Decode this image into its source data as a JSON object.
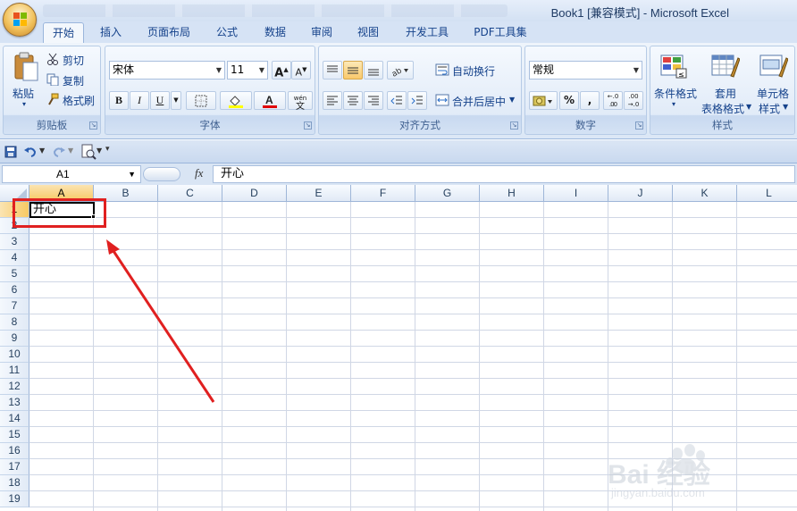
{
  "window": {
    "title": "Book1  [兼容模式] - Microsoft Excel"
  },
  "tabs": [
    {
      "label": "开始",
      "active": true
    },
    {
      "label": "插入"
    },
    {
      "label": "页面布局"
    },
    {
      "label": "公式"
    },
    {
      "label": "数据"
    },
    {
      "label": "审阅"
    },
    {
      "label": "视图"
    },
    {
      "label": "开发工具"
    },
    {
      "label": "PDF工具集"
    }
  ],
  "ribbon": {
    "clipboard": {
      "label": "剪贴板",
      "paste": "粘贴",
      "cut": "剪切",
      "copy": "复制",
      "format_painter": "格式刷"
    },
    "font": {
      "label": "字体",
      "font_name": "宋体",
      "font_size": "11",
      "bold": "B",
      "italic": "I",
      "underline": "U",
      "grow": "A",
      "shrink": "A",
      "phonetic": "文"
    },
    "alignment": {
      "label": "对齐方式",
      "wrap_text": "自动换行",
      "merge_center": "合并后居中"
    },
    "number": {
      "label": "数字",
      "format": "常规",
      "percent": "%",
      "comma": ",",
      "increase_decimal": ".0",
      "decrease_decimal": ".00"
    },
    "styles": {
      "label": "样式",
      "conditional": "条件格式",
      "table_format_1": "套用",
      "table_format_2": "表格格式",
      "cell_styles_1": "单元格",
      "cell_styles_2": "样式"
    }
  },
  "formula_bar": {
    "name_box": "A1",
    "fx": "fx",
    "value": "开心"
  },
  "sheet": {
    "columns": [
      "A",
      "B",
      "C",
      "D",
      "E",
      "F",
      "G",
      "H",
      "I",
      "J",
      "K",
      "L"
    ],
    "rows": [
      "1",
      "2",
      "3",
      "4",
      "5",
      "6",
      "7",
      "8",
      "9",
      "10",
      "11",
      "12",
      "13",
      "14",
      "15",
      "16",
      "17",
      "18",
      "19"
    ],
    "active_cell": "A1",
    "cell_a1": "开心"
  },
  "watermark": {
    "text": "Bai 经验",
    "url": "jingyan.baidu.com"
  },
  "colors": {
    "annotation_red": "#e02020",
    "selection_header": "#f7c963",
    "ribbon_text": "#15428b"
  }
}
